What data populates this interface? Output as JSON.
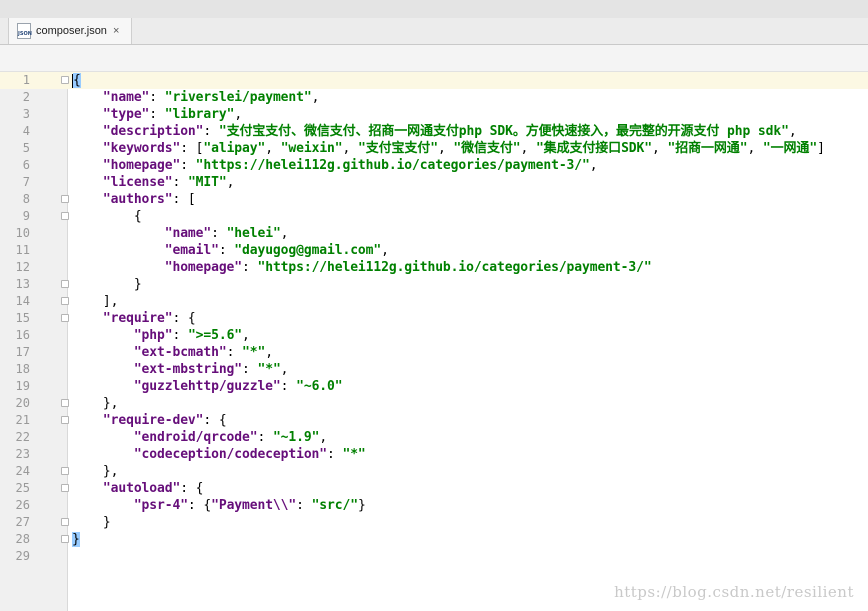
{
  "tab": {
    "filename": "composer.json",
    "icon_text": "JSON",
    "close_glyph": "×"
  },
  "editor": {
    "lines": [
      {
        "n": "1",
        "tokens": [
          {
            "t": "p",
            "v": "{"
          }
        ]
      },
      {
        "n": "2",
        "tokens": [
          {
            "t": "p",
            "v": "    "
          },
          {
            "t": "k",
            "v": "\"name\""
          },
          {
            "t": "p",
            "v": ": "
          },
          {
            "t": "s",
            "v": "\"riverslei/payment\""
          },
          {
            "t": "p",
            "v": ","
          }
        ]
      },
      {
        "n": "3",
        "tokens": [
          {
            "t": "p",
            "v": "    "
          },
          {
            "t": "k",
            "v": "\"type\""
          },
          {
            "t": "p",
            "v": ": "
          },
          {
            "t": "s",
            "v": "\"library\""
          },
          {
            "t": "p",
            "v": ","
          }
        ]
      },
      {
        "n": "4",
        "tokens": [
          {
            "t": "p",
            "v": "    "
          },
          {
            "t": "k",
            "v": "\"description\""
          },
          {
            "t": "p",
            "v": ": "
          },
          {
            "t": "s",
            "v": "\"支付宝支付、微信支付、招商一网通支付php SDK。方便快速接入，最完整的开源支付 php sdk\""
          },
          {
            "t": "p",
            "v": ","
          }
        ]
      },
      {
        "n": "5",
        "tokens": [
          {
            "t": "p",
            "v": "    "
          },
          {
            "t": "k",
            "v": "\"keywords\""
          },
          {
            "t": "p",
            "v": ": ["
          },
          {
            "t": "s",
            "v": "\"alipay\""
          },
          {
            "t": "p",
            "v": ", "
          },
          {
            "t": "s",
            "v": "\"weixin\""
          },
          {
            "t": "p",
            "v": ", "
          },
          {
            "t": "s",
            "v": "\"支付宝支付\""
          },
          {
            "t": "p",
            "v": ", "
          },
          {
            "t": "s",
            "v": "\"微信支付\""
          },
          {
            "t": "p",
            "v": ", "
          },
          {
            "t": "s",
            "v": "\"集成支付接口SDK\""
          },
          {
            "t": "p",
            "v": ", "
          },
          {
            "t": "s",
            "v": "\"招商一网通\""
          },
          {
            "t": "p",
            "v": ", "
          },
          {
            "t": "s",
            "v": "\"一网通\""
          },
          {
            "t": "p",
            "v": "]"
          }
        ]
      },
      {
        "n": "6",
        "tokens": [
          {
            "t": "p",
            "v": "    "
          },
          {
            "t": "k",
            "v": "\"homepage\""
          },
          {
            "t": "p",
            "v": ": "
          },
          {
            "t": "s",
            "v": "\"https://helei112g.github.io/categories/payment-3/\""
          },
          {
            "t": "p",
            "v": ","
          }
        ]
      },
      {
        "n": "7",
        "tokens": [
          {
            "t": "p",
            "v": "    "
          },
          {
            "t": "k",
            "v": "\"license\""
          },
          {
            "t": "p",
            "v": ": "
          },
          {
            "t": "s",
            "v": "\"MIT\""
          },
          {
            "t": "p",
            "v": ","
          }
        ]
      },
      {
        "n": "8",
        "tokens": [
          {
            "t": "p",
            "v": "    "
          },
          {
            "t": "k",
            "v": "\"authors\""
          },
          {
            "t": "p",
            "v": ": ["
          }
        ]
      },
      {
        "n": "9",
        "tokens": [
          {
            "t": "p",
            "v": "        {"
          }
        ]
      },
      {
        "n": "10",
        "tokens": [
          {
            "t": "p",
            "v": "            "
          },
          {
            "t": "k",
            "v": "\"name\""
          },
          {
            "t": "p",
            "v": ": "
          },
          {
            "t": "s",
            "v": "\"helei\""
          },
          {
            "t": "p",
            "v": ","
          }
        ]
      },
      {
        "n": "11",
        "tokens": [
          {
            "t": "p",
            "v": "            "
          },
          {
            "t": "k",
            "v": "\"email\""
          },
          {
            "t": "p",
            "v": ": "
          },
          {
            "t": "s",
            "v": "\"dayugog@gmail.com\""
          },
          {
            "t": "p",
            "v": ","
          }
        ]
      },
      {
        "n": "12",
        "tokens": [
          {
            "t": "p",
            "v": "            "
          },
          {
            "t": "k",
            "v": "\"homepage\""
          },
          {
            "t": "p",
            "v": ": "
          },
          {
            "t": "s",
            "v": "\"https://helei112g.github.io/categories/payment-3/\""
          }
        ]
      },
      {
        "n": "13",
        "tokens": [
          {
            "t": "p",
            "v": "        }"
          }
        ]
      },
      {
        "n": "14",
        "tokens": [
          {
            "t": "p",
            "v": "    ],"
          }
        ]
      },
      {
        "n": "15",
        "tokens": [
          {
            "t": "p",
            "v": "    "
          },
          {
            "t": "k",
            "v": "\"require\""
          },
          {
            "t": "p",
            "v": ": {"
          }
        ]
      },
      {
        "n": "16",
        "tokens": [
          {
            "t": "p",
            "v": "        "
          },
          {
            "t": "k",
            "v": "\"php\""
          },
          {
            "t": "p",
            "v": ": "
          },
          {
            "t": "s",
            "v": "\">=5.6\""
          },
          {
            "t": "p",
            "v": ","
          }
        ]
      },
      {
        "n": "17",
        "tokens": [
          {
            "t": "p",
            "v": "        "
          },
          {
            "t": "k",
            "v": "\"ext-bcmath\""
          },
          {
            "t": "p",
            "v": ": "
          },
          {
            "t": "s",
            "v": "\"*\""
          },
          {
            "t": "p",
            "v": ","
          }
        ]
      },
      {
        "n": "18",
        "tokens": [
          {
            "t": "p",
            "v": "        "
          },
          {
            "t": "k",
            "v": "\"ext-mbstring\""
          },
          {
            "t": "p",
            "v": ": "
          },
          {
            "t": "s",
            "v": "\"*\""
          },
          {
            "t": "p",
            "v": ","
          }
        ]
      },
      {
        "n": "19",
        "tokens": [
          {
            "t": "p",
            "v": "        "
          },
          {
            "t": "k",
            "v": "\"guzzlehttp/guzzle\""
          },
          {
            "t": "p",
            "v": ": "
          },
          {
            "t": "s",
            "v": "\"~6.0\""
          }
        ]
      },
      {
        "n": "20",
        "tokens": [
          {
            "t": "p",
            "v": "    },"
          }
        ]
      },
      {
        "n": "21",
        "tokens": [
          {
            "t": "p",
            "v": "    "
          },
          {
            "t": "k",
            "v": "\"require-dev\""
          },
          {
            "t": "p",
            "v": ": {"
          }
        ]
      },
      {
        "n": "22",
        "tokens": [
          {
            "t": "p",
            "v": "        "
          },
          {
            "t": "k",
            "v": "\"endroid/qrcode\""
          },
          {
            "t": "p",
            "v": ": "
          },
          {
            "t": "s",
            "v": "\"~1.9\""
          },
          {
            "t": "p",
            "v": ","
          }
        ]
      },
      {
        "n": "23",
        "tokens": [
          {
            "t": "p",
            "v": "        "
          },
          {
            "t": "k",
            "v": "\"codeception/codeception\""
          },
          {
            "t": "p",
            "v": ": "
          },
          {
            "t": "s",
            "v": "\"*\""
          }
        ]
      },
      {
        "n": "24",
        "tokens": [
          {
            "t": "p",
            "v": "    },"
          }
        ]
      },
      {
        "n": "25",
        "tokens": [
          {
            "t": "p",
            "v": "    "
          },
          {
            "t": "k",
            "v": "\"autoload\""
          },
          {
            "t": "p",
            "v": ": {"
          }
        ]
      },
      {
        "n": "26",
        "tokens": [
          {
            "t": "p",
            "v": "        "
          },
          {
            "t": "k",
            "v": "\"psr-4\""
          },
          {
            "t": "p",
            "v": ": {"
          },
          {
            "t": "k",
            "v": "\"Payment\\\\\""
          },
          {
            "t": "p",
            "v": ": "
          },
          {
            "t": "s",
            "v": "\"src/\""
          },
          {
            "t": "p",
            "v": "}"
          }
        ]
      },
      {
        "n": "27",
        "tokens": [
          {
            "t": "p",
            "v": "    }"
          }
        ]
      },
      {
        "n": "28",
        "tokens": [
          {
            "t": "p",
            "v": "}"
          }
        ]
      },
      {
        "n": "29",
        "tokens": []
      }
    ],
    "fold_markers": [
      "1",
      "8",
      "9",
      "13",
      "14",
      "15",
      "20",
      "21",
      "24",
      "25",
      "27",
      "28"
    ],
    "brace_highlight_lines": [
      "1",
      "28"
    ],
    "colors": {
      "key": "#660e7a",
      "string": "#008000",
      "current_line": "#fcf8e3",
      "brace_highlight": "#99ccff"
    }
  },
  "watermark": "https://blog.csdn.net/resilient"
}
